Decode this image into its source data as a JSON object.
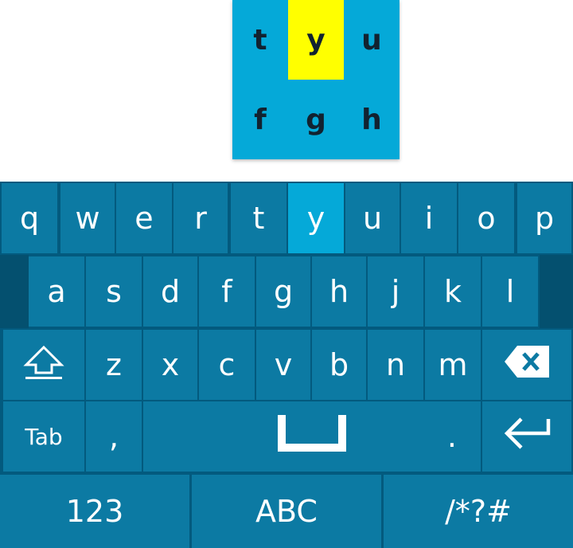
{
  "popup": {
    "keys": [
      "t",
      "y",
      "u",
      "f",
      "g",
      "h"
    ],
    "highlighted_key": "y"
  },
  "keyboard": {
    "row1": [
      "q",
      "w",
      "e",
      "r",
      "t",
      "y",
      "u",
      "i",
      "o",
      "p"
    ],
    "row2": [
      "a",
      "s",
      "d",
      "f",
      "g",
      "h",
      "j",
      "k",
      "l"
    ],
    "row3": [
      "z",
      "x",
      "c",
      "v",
      "b",
      "n",
      "m"
    ],
    "row4": {
      "tab": "Tab",
      "comma": ",",
      "period": "."
    },
    "row5": {
      "numbers": "123",
      "letters": "ABC",
      "symbols": "/*?#"
    },
    "pressed_key": "y",
    "icons": {
      "shift": "shift-icon",
      "backspace": "backspace-icon",
      "space": "space-bar-icon",
      "enter": "enter-icon"
    },
    "colors": {
      "key": "#0c7aa3",
      "key_active": "#05a9d8",
      "background": "#035a7e",
      "popup": "#05a9d8",
      "popup_highlight": "#ffff00"
    }
  }
}
